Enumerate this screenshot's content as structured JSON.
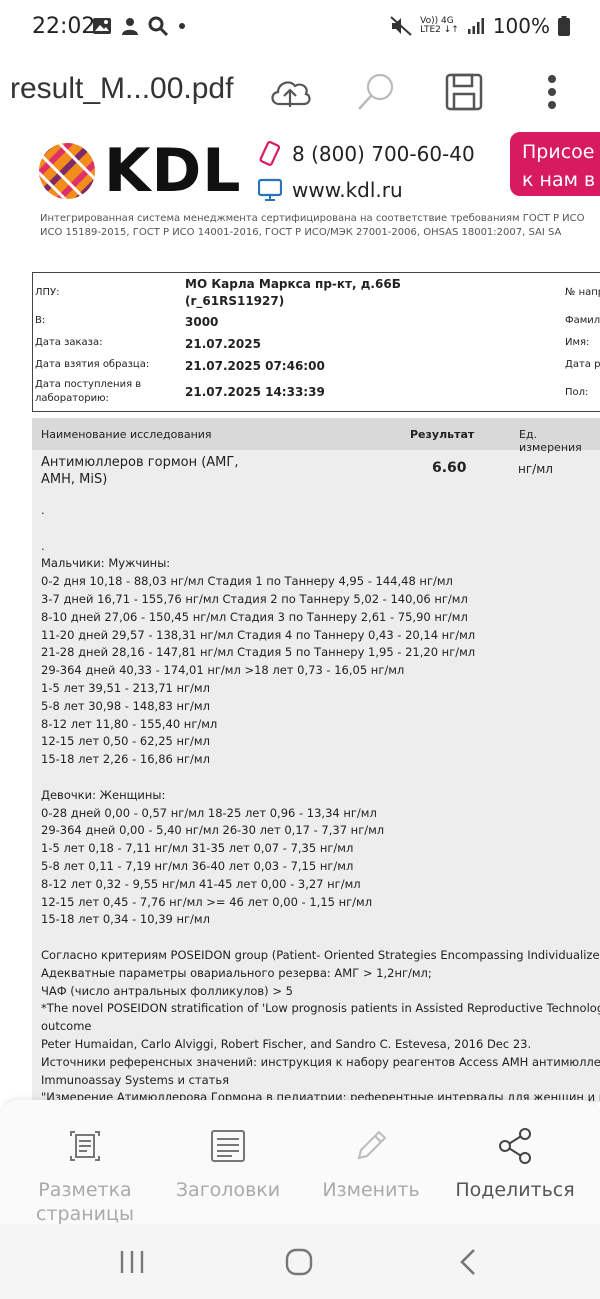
{
  "status": {
    "time": "22:02",
    "battery": "100%",
    "network_top": "Vo)) 4G",
    "network_bottom": "LTE2 ↓↑"
  },
  "app_bar": {
    "file_title": "result_M...00.pdf"
  },
  "doc": {
    "logo_text": "KDL",
    "phone": "8 (800) 700-60-40",
    "website": "www.kdl.ru",
    "promo_line1": "Присое",
    "promo_line2": "к нам в",
    "cert_line1": "Интегрированная система менеджмента сертифицирована на соответствие требованиям ГОСТ Р ИСО",
    "cert_line2": "ИСО 15189-2015, ГОСТ Р ИСО 14001-2016, ГОСТ Р ИСО/МЭК 27001-2006, OHSAS 18001:2007, SAI SA",
    "info": {
      "lpu_label": "ЛПУ:",
      "lpu_value_1": "МО Карла Маркса пр-кт, д.66Б",
      "lpu_value_2": "(r_61RS11927)",
      "b_label": "В:",
      "b_value": "3000",
      "order_label": "Дата заказа:",
      "order_value": "21.07.2025",
      "sample_label": "Дата взятия образца:",
      "sample_value": "21.07.2025 07:46:00",
      "lab_label_1": "Дата поступления в",
      "lab_label_2": "лабораторию:",
      "lab_value": "21.07.2025 14:33:39",
      "right_1": "№ напр",
      "right_2": "Фамил",
      "right_3": "Имя:",
      "right_4": "Дата ро",
      "right_5": "Пол:"
    },
    "results": {
      "col_name": "Наименование исследования",
      "col_result": "Результат",
      "col_unit": "Ед. измерения",
      "test_name_1": "Антимюллеров гормон (АМГ,",
      "test_name_2": "AMH, MiS)",
      "test_value": "6.60",
      "test_unit": "нг/мл",
      "reference": ".\n\n.\nМальчики: Мужчины:\n0-2 дня 10,18 - 88,03 нг/мл Стадия 1 по Таннеру 4,95 - 144,48 нг/мл\n3-7 дней 16,71 - 155,76 нг/мл Стадия 2 по Таннеру 5,02 - 140,06 нг/мл\n8-10 дней 27,06 - 150,45 нг/мл Стадия 3 по Таннеру 2,61 - 75,90 нг/мл\n11-20 дней 29,57 - 138,31 нг/мл Стадия 4 по Таннеру 0,43 - 20,14 нг/мл\n21-28 дней 28,16 - 147,81 нг/мл Стадия 5 по Таннеру 1,95 - 21,20 нг/мл\n29-364 дней 40,33 - 174,01 нг/мл >18 лет 0,73 - 16,05 нг/мл\n1-5 лет 39,51 - 213,71 нг/мл\n5-8 лет 30,98 - 148,83 нг/мл\n8-12 лет 11,80 - 155,40 нг/мл\n12-15 лет 0,50 - 62,25 нг/мл\n15-18 лет 2,26 - 16,86 нг/мл\n\nДевочки: Женщины:\n0-28 дней 0,00 - 0,57 нг/мл 18-25 лет 0,96 - 13,34 нг/мл\n29-364 дней 0,00 - 5,40 нг/мл 26-30 лет 0,17 - 7,37 нг/мл\n1-5 лет 0,18 - 7,11 нг/мл 31-35 лет 0,07 - 7,35 нг/мл\n5-8 лет 0,11 - 7,19 нг/мл 36-40 лет 0,03 - 7,15 нг/мл\n8-12 лет 0,32 - 9,55 нг/мл 41-45 лет 0,00 - 3,27 нг/мл\n12-15 лет 0,45 - 7,76 нг/мл >= 46 лет 0,00 - 1,15 нг/мл\n15-18 лет 0,34 - 10,39 нг/мл\n\nСогласно критериям POSEIDON group (Patient- Oriented Strategies Encompassing Individualize D\nАдекватные параметры овариального резерва: АМГ > 1,2нг/мл;\nЧАФ (число антральных фолликулов) > 5\n*The novel POSEIDON stratification of 'Low prognosis patients in Assisted Reproductive Technology\noutcome\nPeter Humaidan, Carlo Alviggi, Robert Fischer, and Sandro C. Estevesa, 2016 Dec 23.\nИсточники референсных значений: инструкция к набору реагентов Access AMH антимюллеро\nImmunoassay Systems и статья\n\"Измерение Атимюллерова Гормона в педиатрии: референтные интервалы для женщин и му"
    }
  },
  "bottom_bar": {
    "layout_label_1": "Разметка",
    "layout_label_2": "страницы",
    "headings_label": "Заголовки",
    "edit_label": "Изменить",
    "share_label": "Поделиться"
  }
}
